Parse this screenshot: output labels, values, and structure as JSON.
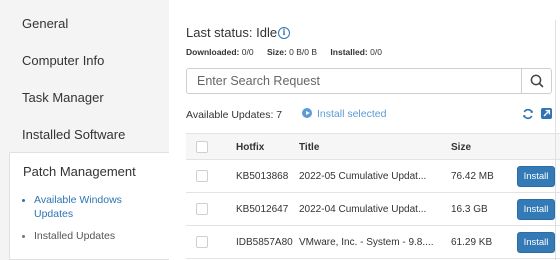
{
  "accent_colors": {
    "primary": "#337ab7",
    "link": "#2e74b5",
    "muted_link": "#5b9bd5",
    "edge_orange": "#e8821e",
    "edge_green": "#3c9a4e"
  },
  "sidebar": {
    "items": [
      {
        "label": "General"
      },
      {
        "label": "Computer Info"
      },
      {
        "label": "Task Manager"
      },
      {
        "label": "Installed Software"
      }
    ],
    "active": {
      "label": "Patch Management",
      "subitems": [
        {
          "label": "Available Windows Updates",
          "bullet": "•"
        },
        {
          "label": "Installed Updates",
          "bullet": "•"
        }
      ]
    }
  },
  "status": {
    "label": "Last status:",
    "value": "Idle",
    "info_icon": "info-icon",
    "info_glyph": "i"
  },
  "stats": {
    "downloaded_label": "Downloaded:",
    "downloaded_value": "0/0",
    "size_label": "Size:",
    "size_value": "0 B/0 B",
    "installed_label": "Installed:",
    "installed_value": "0/0"
  },
  "search": {
    "placeholder": "Enter Search Request",
    "icon": "search-icon"
  },
  "updates": {
    "available_label": "Available Updates: 7",
    "install_selected_label": "Install selected",
    "refresh_icon": "refresh-icon",
    "open_icon": "external-link-icon"
  },
  "table": {
    "columns": {
      "hotfix": "Hotfix",
      "title": "Title",
      "size": "Size"
    },
    "rows": [
      {
        "hotfix": "KB5013868",
        "title": "2022-05 Cumulative Updat...",
        "size": "76.42 MB",
        "action": "Install"
      },
      {
        "hotfix": "KB5012647",
        "title": "2022-04 Cumulative Updat...",
        "size": "16.3 GB",
        "action": "Install"
      },
      {
        "hotfix": "IDB5857A80",
        "title": "VMware, Inc. - System - 9.8....",
        "size": "61.29 KB",
        "action": "Install"
      }
    ]
  }
}
